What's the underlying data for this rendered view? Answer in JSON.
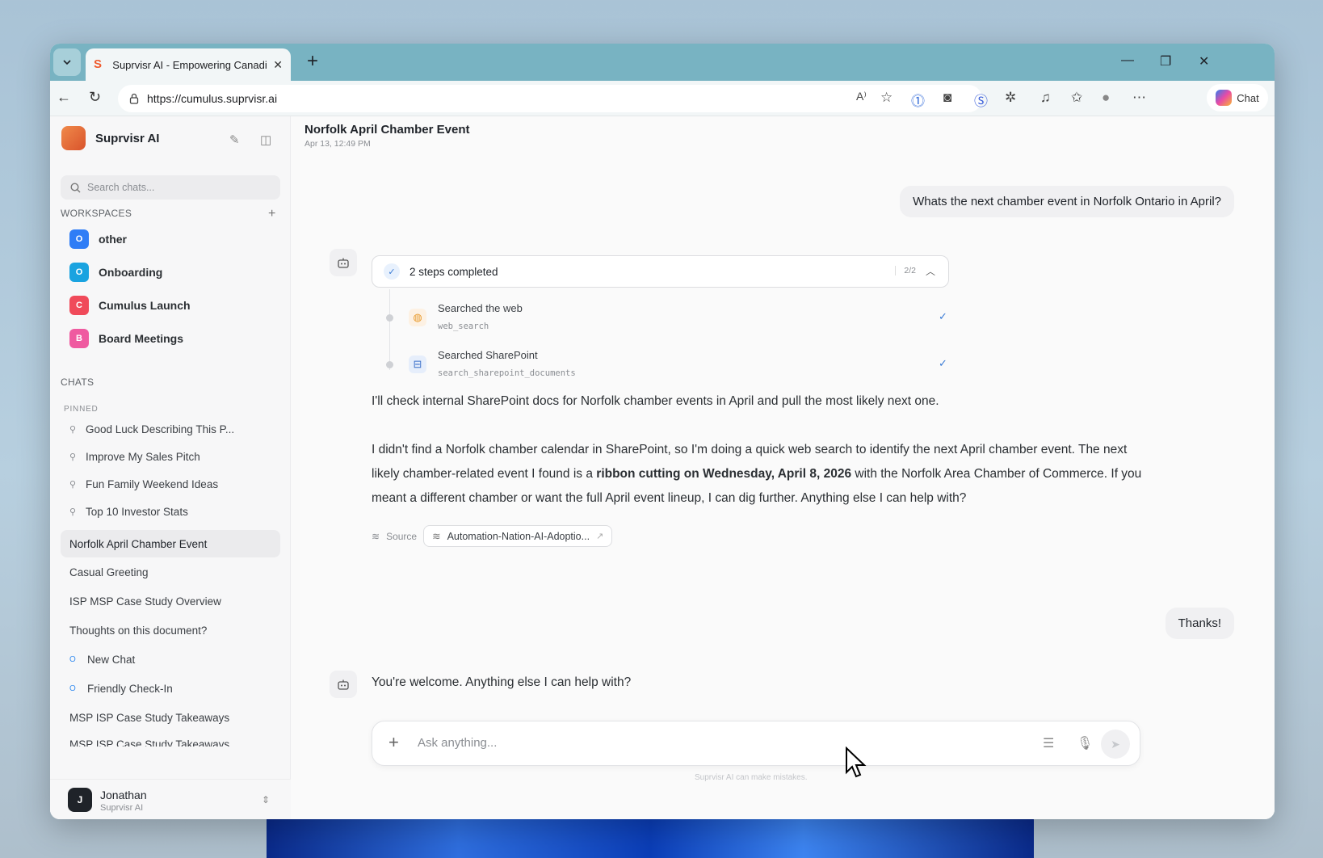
{
  "browser": {
    "tab_title": "Suprvisr AI - Empowering Canadia",
    "url": "https://cumulus.suprvisr.ai",
    "chat_label": "Chat"
  },
  "sidebar": {
    "brand": "Suprvisr AI",
    "search_placeholder": "Search chats...",
    "workspaces_label": "WORKSPACES",
    "workspaces": [
      {
        "letter": "O",
        "name": "other",
        "color": "#2f7df6"
      },
      {
        "letter": "O",
        "name": "Onboarding",
        "color": "#1aa3e0"
      },
      {
        "letter": "C",
        "name": "Cumulus Launch",
        "color": "#f04a5a"
      },
      {
        "letter": "B",
        "name": "Board Meetings",
        "color": "#ef5aa0"
      }
    ],
    "chats_label": "CHATS",
    "pinned_label": "PINNED",
    "pinned": [
      "Good Luck Describing This P...",
      "Improve My Sales Pitch",
      "Fun Family Weekend Ideas",
      "Top 10 Investor Stats"
    ],
    "chats": [
      "Norfolk April Chamber Event",
      "Casual Greeting",
      "ISP MSP Case Study Overview",
      "Thoughts on this document?",
      "New Chat",
      "Friendly Check-In",
      "MSP ISP Case Study Takeaways",
      "MSP ISP Case Study Takeaways"
    ],
    "ws_badge_letter": "O",
    "user": {
      "initial": "J",
      "name": "Jonathan",
      "org": "Suprvisr AI"
    }
  },
  "conversation": {
    "title": "Norfolk April Chamber Event",
    "date": "Apr 13, 12:49 PM",
    "user_msg_1": "Whats the next chamber event in Norfolk Ontario in April?",
    "steps_label": "2 steps completed",
    "steps_count": "2/2",
    "steps": [
      {
        "title": "Searched the web",
        "code": "web_search"
      },
      {
        "title": "Searched SharePoint",
        "code": "search_sharepoint_documents"
      }
    ],
    "bot_para_1": "I'll check internal SharePoint docs for Norfolk chamber events in April and pull the most likely next one.",
    "bot_para_2a": "I didn't find a Norfolk chamber calendar in SharePoint, so I'm doing a quick web search to identify the next April chamber event. The next likely chamber-related event I found is a ",
    "bot_para_2b": "ribbon cutting on Wednesday, April 8, 2026",
    "bot_para_2c": " with the Norfolk Area Chamber of Commerce. If you meant a different chamber or want the full April event lineup, I can dig further. Anything else I can help with?",
    "source_label": "Source",
    "source_chip": "Automation-Nation-AI-Adoptio...",
    "user_msg_2": "Thanks!",
    "bot_reply_2": "You're welcome. Anything else I can help with?"
  },
  "composer": {
    "placeholder": "Ask anything...",
    "disclaimer": "Suprvisr AI can make mistakes."
  }
}
